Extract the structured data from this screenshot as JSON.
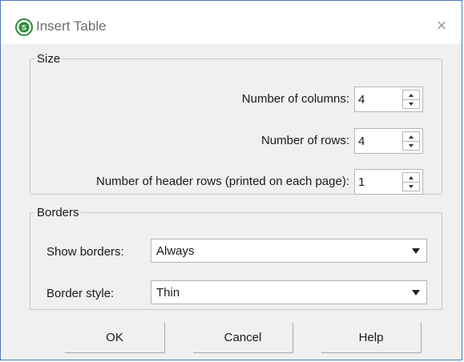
{
  "window": {
    "title": "Insert Table",
    "app_icon": "app-logo-icon",
    "close_glyph": "×"
  },
  "size": {
    "legend": "Size",
    "columns_label": "Number of columns:",
    "columns_value": "4",
    "rows_label": "Number of rows:",
    "rows_value": "4",
    "header_rows_label": "Number of header rows (printed on each page):",
    "header_rows_value": "1"
  },
  "borders": {
    "legend": "Borders",
    "show_label": "Show borders:",
    "show_value": "Always",
    "style_label": "Border style:",
    "style_value": "Thin"
  },
  "buttons": {
    "ok": "OK",
    "cancel": "Cancel",
    "help": "Help"
  },
  "colors": {
    "accent_border": "#4a7bb8",
    "app_icon_green": "#2e8b3a",
    "dialog_bg": "#f0f0f0"
  }
}
